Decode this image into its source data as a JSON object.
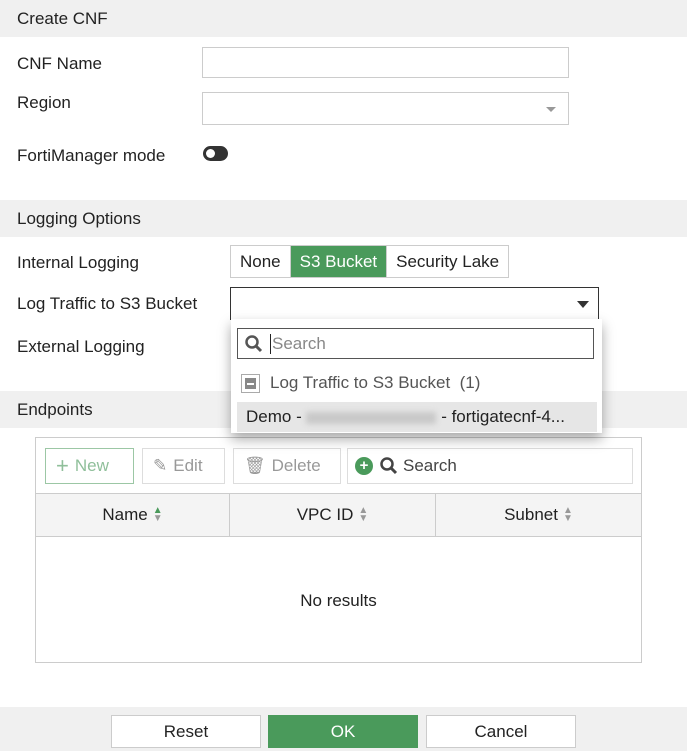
{
  "sections": {
    "create": "Create CNF",
    "logging": "Logging Options",
    "endpoints": "Endpoints"
  },
  "form": {
    "cnf_name_label": "CNF Name",
    "cnf_name_value": "",
    "region_label": "Region",
    "region_value": "",
    "fortimanager_label": "FortiManager mode",
    "fortimanager_on": false
  },
  "logging": {
    "internal_label": "Internal Logging",
    "options": [
      "None",
      "S3 Bucket",
      "Security Lake"
    ],
    "selected": "S3 Bucket",
    "s3_label": "Log Traffic to S3 Bucket",
    "external_label": "External Logging"
  },
  "dropdown": {
    "search_placeholder": "Search",
    "group_label": "Log Traffic to S3 Bucket",
    "group_count": "(1)",
    "option_prefix": "Demo -",
    "option_suffix": "- fortigatecnf-4..."
  },
  "table": {
    "new": "New",
    "edit": "Edit",
    "delete": "Delete",
    "search_placeholder": "Search",
    "columns": [
      "Name",
      "VPC ID",
      "Subnet"
    ],
    "empty": "No results"
  },
  "footer": {
    "reset": "Reset",
    "ok": "OK",
    "cancel": "Cancel"
  },
  "colors": {
    "accent": "#4a9a5b"
  }
}
